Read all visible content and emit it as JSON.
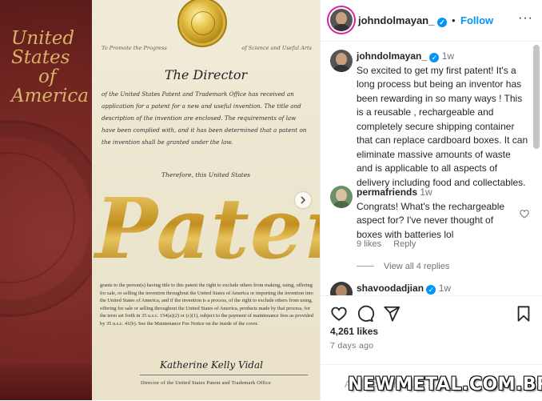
{
  "image": {
    "usa_title": [
      "United",
      "States",
      "of",
      "America"
    ],
    "motto_left": "To Promote the Progress",
    "motto_right": "of Science and Useful Arts",
    "director": "The Director",
    "body": "of the United States Patent and Trademark Office has received an application for a patent for a new and useful invention. The title and description of the invention are enclosed. The requirements of law have been complied with, and it has been determined that a patent on the invention shall be granted under the law.",
    "therefore": "Therefore, this United States",
    "patent_word": "Patent",
    "legal": "grants to the person(s) having title to this patent the right to exclude others from making, using, offering for sale, or selling the invention throughout the United States of America or importing the invention into the United States of America, and if the invention is a process, of the right to exclude others from using, offering for sale or selling throughout the United States of America, products made by that process, for the term set forth in 35 u.s.c. 154(a)(2) or (c)(1), subject to the payment of maintenance fees as provided by 35 u.s.c. 41(b). See the Maintenance Fee Notice on the inside of the cover.",
    "signature": "Katherine Kelly Vidal",
    "director_office": "Director of the United States Patent and Trademark Office"
  },
  "header": {
    "username": "johndolmayan_",
    "separator": "•",
    "follow": "Follow",
    "more": "···"
  },
  "caption": {
    "username": "johndolmayan_",
    "time": "1w",
    "text": "So excited to get my first patent! It's a long process but being an inventor has been rewarding in so many ways ! This is a reusable , rechargeable and completely secure shipping container that can replace cardboard boxes. It can eliminate massive amounts of waste and is applicable to all aspects of delivery including food and collectables."
  },
  "comments": [
    {
      "username": "permafriends",
      "time": "1w",
      "text": "Congrats! What's the rechargeable aspect for? I've never thought of boxes with batteries lol",
      "likes": "9 likes",
      "reply": "Reply",
      "view_replies": "View all 4 replies"
    },
    {
      "username": "shavoodadjian",
      "time": "1w"
    }
  ],
  "stats": {
    "likes": "4,261 likes",
    "ago": "7 days ago"
  },
  "add_comment_placeholder": "Add a comment...",
  "watermark": "NEWMETAL.COM.BR",
  "icons": [
    "verified-badge",
    "heart-icon",
    "comment-icon",
    "share-icon",
    "bookmark-icon",
    "chevron-right-icon"
  ],
  "colors": {
    "accent": "#0095f6",
    "text": "#262626",
    "muted": "#737373"
  }
}
